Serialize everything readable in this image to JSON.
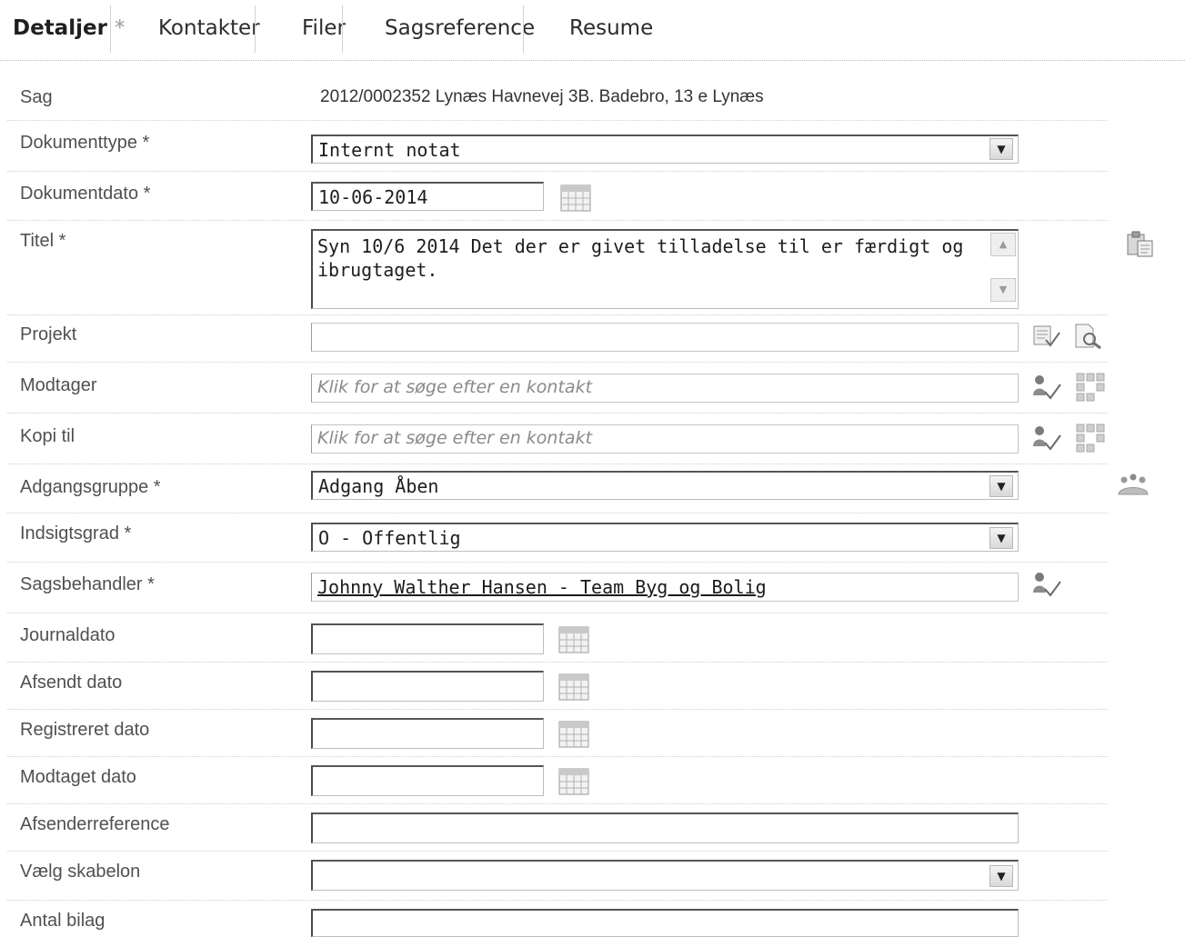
{
  "tabs": [
    {
      "label": "Detaljer",
      "marker": "*",
      "active": true
    },
    {
      "label": "Kontakter"
    },
    {
      "label": "Filer"
    },
    {
      "label": "Sagsreference"
    },
    {
      "label": "Resume"
    }
  ],
  "form": {
    "sag": {
      "label": "Sag",
      "value": "2012/0002352 Lynæs Havnevej 3B. Badebro, 13 e Lynæs"
    },
    "dokumenttype": {
      "label": "Dokumenttype *",
      "value": "Internt notat"
    },
    "dokumentdato": {
      "label": "Dokumentdato *",
      "value": "10-06-2014"
    },
    "titel": {
      "label": "Titel *",
      "value": "Syn 10/6 2014 Det der er givet tilladelse til er færdigt og ibrugtaget."
    },
    "projekt": {
      "label": "Projekt",
      "value": ""
    },
    "modtager": {
      "label": "Modtager",
      "placeholder": "Klik for at søge efter en kontakt"
    },
    "kopi_til": {
      "label": "Kopi til",
      "placeholder": "Klik for at søge efter en kontakt"
    },
    "adgangsgruppe": {
      "label": "Adgangsgruppe *",
      "value": "Adgang Åben"
    },
    "indsigtsgrad": {
      "label": "Indsigtsgrad *",
      "value": "O - Offentlig"
    },
    "sagsbehandler": {
      "label": "Sagsbehandler *",
      "value": "Johnny Walther Hansen - Team Byg og Bolig"
    },
    "journaldato": {
      "label": "Journaldato",
      "value": ""
    },
    "afsendt_dato": {
      "label": "Afsendt dato",
      "value": ""
    },
    "registreret_dato": {
      "label": "Registreret dato",
      "value": ""
    },
    "modtaget_dato": {
      "label": "Modtaget dato",
      "value": ""
    },
    "afsenderreference": {
      "label": "Afsenderreference",
      "value": ""
    },
    "vaelg_skabelon": {
      "label": "Vælg skabelon",
      "value": ""
    },
    "antal_bilag": {
      "label": "Antal bilag",
      "value": ""
    }
  },
  "icons": {
    "calendar": "calendar-icon",
    "paste": "paste-icon",
    "select": "select-list-icon",
    "search": "search-document-icon",
    "contact": "contact-search-icon",
    "grid": "address-book-icon",
    "group": "group-icon",
    "dropdown": "chevron-down-icon"
  }
}
